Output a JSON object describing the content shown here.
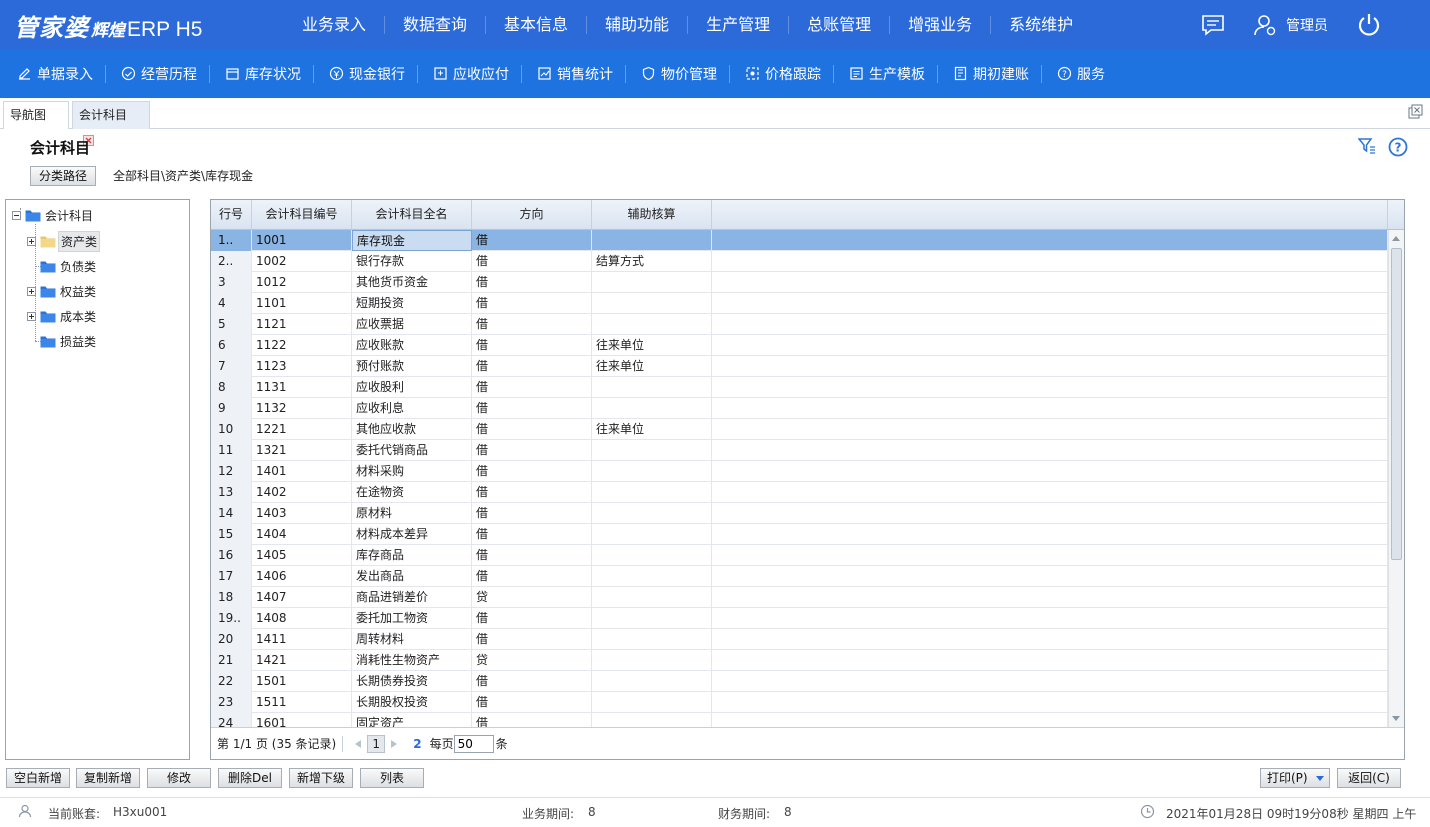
{
  "header": {
    "logo_main": "管家婆",
    "logo_sub": "辉煌",
    "logo_product": "ERP H5",
    "nav": [
      "业务录入",
      "数据查询",
      "基本信息",
      "辅助功能",
      "生产管理",
      "总账管理",
      "增强业务",
      "系统维护"
    ],
    "user_label": "管理员"
  },
  "toolbar": {
    "items": [
      {
        "label": "单据录入",
        "icon": "edit-icon"
      },
      {
        "label": "经营历程",
        "icon": "history-icon"
      },
      {
        "label": "库存状况",
        "icon": "inventory-icon"
      },
      {
        "label": "现金银行",
        "icon": "cash-icon"
      },
      {
        "label": "应收应付",
        "icon": "receivable-icon"
      },
      {
        "label": "销售统计",
        "icon": "sales-chart-icon"
      },
      {
        "label": "物价管理",
        "icon": "price-shield-icon"
      },
      {
        "label": "价格跟踪",
        "icon": "price-track-icon"
      },
      {
        "label": "生产模板",
        "icon": "template-icon"
      },
      {
        "label": "期初建账",
        "icon": "ledger-icon"
      },
      {
        "label": "服务",
        "icon": "help-icon"
      }
    ]
  },
  "tabs": {
    "nav_tab": "导航图",
    "active_tab": "会计科目"
  },
  "page": {
    "title": "会计科目",
    "path_button": "分类路径",
    "path_text": "全部科目\\资产类\\库存现金"
  },
  "tree": {
    "root": "会计科目",
    "children": [
      "资产类",
      "负债类",
      "权益类",
      "成本类",
      "损益类"
    ]
  },
  "grid": {
    "columns": [
      "行号",
      "会计科目编号",
      "会计科目全名",
      "方向",
      "辅助核算"
    ],
    "rows": [
      [
        "1..",
        "1001",
        "库存现金",
        "借",
        ""
      ],
      [
        "2..",
        "1002",
        "银行存款",
        "借",
        "结算方式"
      ],
      [
        "3",
        "1012",
        "其他货币资金",
        "借",
        ""
      ],
      [
        "4",
        "1101",
        "短期投资",
        "借",
        ""
      ],
      [
        "5",
        "1121",
        "应收票据",
        "借",
        ""
      ],
      [
        "6",
        "1122",
        "应收账款",
        "借",
        "往来单位"
      ],
      [
        "7",
        "1123",
        "预付账款",
        "借",
        "往来单位"
      ],
      [
        "8",
        "1131",
        "应收股利",
        "借",
        ""
      ],
      [
        "9",
        "1132",
        "应收利息",
        "借",
        ""
      ],
      [
        "10",
        "1221",
        "其他应收款",
        "借",
        "往来单位"
      ],
      [
        "11",
        "1321",
        "委托代销商品",
        "借",
        ""
      ],
      [
        "12",
        "1401",
        "材料采购",
        "借",
        ""
      ],
      [
        "13",
        "1402",
        "在途物资",
        "借",
        ""
      ],
      [
        "14",
        "1403",
        "原材料",
        "借",
        ""
      ],
      [
        "15",
        "1404",
        "材料成本差异",
        "借",
        ""
      ],
      [
        "16",
        "1405",
        "库存商品",
        "借",
        ""
      ],
      [
        "17",
        "1406",
        "发出商品",
        "借",
        ""
      ],
      [
        "18",
        "1407",
        "商品进销差价",
        "贷",
        ""
      ],
      [
        "19..",
        "1408",
        "委托加工物资",
        "借",
        ""
      ],
      [
        "20",
        "1411",
        "周转材料",
        "借",
        ""
      ],
      [
        "21",
        "1421",
        "消耗性生物资产",
        "贷",
        ""
      ],
      [
        "22",
        "1501",
        "长期债券投资",
        "借",
        ""
      ],
      [
        "23",
        "1511",
        "长期股权投资",
        "借",
        ""
      ],
      [
        "24",
        "1601",
        "固定资产",
        "借",
        ""
      ]
    ]
  },
  "pager": {
    "summary": "第 1/1 页 (35 条记录)",
    "current_page": "1",
    "refresh": "2",
    "per_page_label": "每页",
    "per_page_value": "50",
    "unit": "条"
  },
  "actions": {
    "blank_new": "空白新增",
    "copy_new": "复制新增",
    "modify": "修改",
    "delete": "删除Del",
    "add_child": "新增下级",
    "list": "列表",
    "print": "打印(P)",
    "back": "返回(C)"
  },
  "status": {
    "account_label": "当前账套:",
    "account_value": "H3xu001",
    "biz_period_label": "业务期间:",
    "biz_period_value": "8",
    "fin_period_label": "财务期间:",
    "fin_period_value": "8",
    "datetime": "2021年01月28日 09时19分08秒 星期四 上午"
  },
  "colors": {
    "header_bg": "#2b6ad8",
    "toolbar_bg": "#1f73e0",
    "selected_row": "#8ab4e3"
  }
}
